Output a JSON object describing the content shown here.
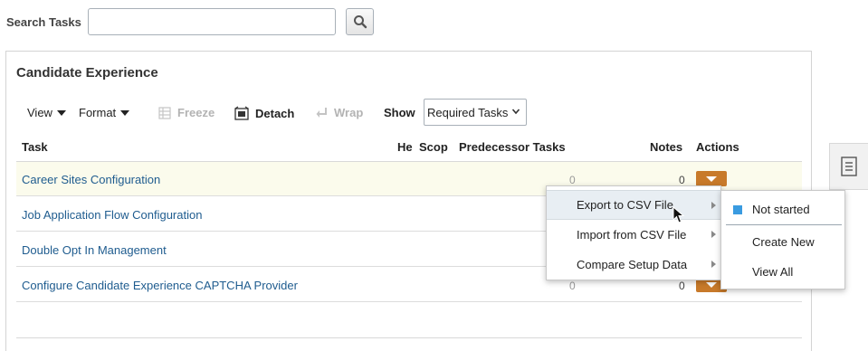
{
  "search": {
    "label": "Search Tasks",
    "value": "",
    "placeholder": "",
    "button_icon": "search-icon"
  },
  "panel": {
    "title": "Candidate Experience"
  },
  "toolbar": {
    "view": "View",
    "format": "Format",
    "freeze": "Freeze",
    "detach": "Detach",
    "wrap": "Wrap",
    "show_label": "Show",
    "show_value": "Required Tasks"
  },
  "columns": {
    "task": "Task",
    "he": "He",
    "scope": "Scop",
    "predecessor": "Predecessor Tasks",
    "notes": "Notes",
    "actions": "Actions"
  },
  "rows": [
    {
      "task": "Career Sites Configuration",
      "predecessor": "0",
      "notes": "0"
    },
    {
      "task": "Job Application Flow Configuration",
      "predecessor": "",
      "notes": ""
    },
    {
      "task": "Double Opt In Management",
      "predecessor": "",
      "notes": ""
    },
    {
      "task": "Configure Candidate Experience CAPTCHA Provider",
      "predecessor": "0",
      "notes": "0"
    }
  ],
  "actions_menu": [
    {
      "label": "Export to CSV File"
    },
    {
      "label": "Import from CSV File"
    },
    {
      "label": "Compare Setup Data"
    }
  ],
  "export_submenu": {
    "status": "Not started",
    "create_new": "Create New",
    "view_all": "View All"
  },
  "colors": {
    "link": "#1f5c8f",
    "action_button": "#c87a2a",
    "status_not_started": "#3a9be0",
    "row_highlight": "#fbfbec"
  }
}
